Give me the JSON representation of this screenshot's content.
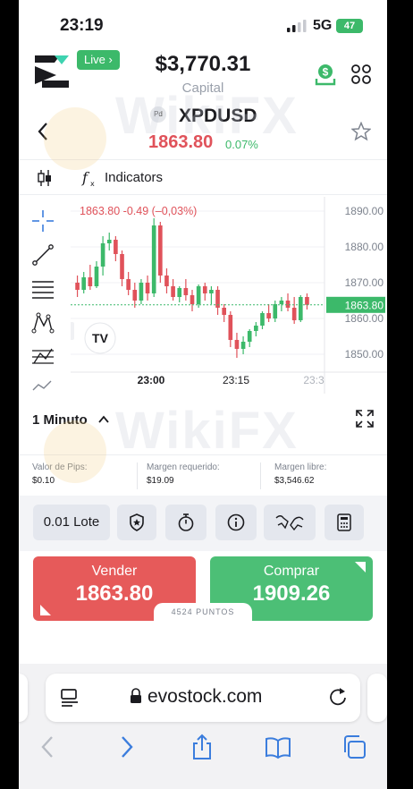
{
  "status_bar": {
    "time": "23:19",
    "network": "5G",
    "battery": "47"
  },
  "header": {
    "live_label": "Live ›",
    "capital_value": "$3,770.31",
    "capital_label": "Capital"
  },
  "instrument": {
    "badge": "Pd",
    "symbol": "XPDUSD",
    "price": "1863.80",
    "change": "0.07%"
  },
  "toolbar": {
    "indicators_label": "Indicators"
  },
  "chart_data": {
    "type": "candlestick",
    "legend_text": "1863.80  -0.49 (–0,03%)",
    "y_ticks": [
      "1890.00",
      "1880.00",
      "1870.00",
      "1860.00",
      "1850.00"
    ],
    "x_ticks": [
      "23:00",
      "23:15",
      "23:3"
    ],
    "last_price_label": "1863.80",
    "ylim": [
      1846,
      1893
    ],
    "candles": [
      {
        "o": 1870.0,
        "h": 1872.0,
        "c": 1868.0,
        "l": 1866.0
      },
      {
        "o": 1868.0,
        "h": 1873.0,
        "c": 1871.5,
        "l": 1867.0
      },
      {
        "o": 1871.5,
        "h": 1875.0,
        "c": 1869.0,
        "l": 1868.0
      },
      {
        "o": 1869.0,
        "h": 1876.0,
        "c": 1874.5,
        "l": 1868.5
      },
      {
        "o": 1874.5,
        "h": 1883.0,
        "c": 1881.0,
        "l": 1872.0
      },
      {
        "o": 1881.0,
        "h": 1884.0,
        "c": 1882.0,
        "l": 1879.0
      },
      {
        "o": 1882.0,
        "h": 1883.0,
        "c": 1878.0,
        "l": 1876.0
      },
      {
        "o": 1878.0,
        "h": 1879.0,
        "c": 1871.0,
        "l": 1869.0
      },
      {
        "o": 1871.0,
        "h": 1873.0,
        "c": 1868.0,
        "l": 1866.5
      },
      {
        "o": 1868.0,
        "h": 1870.0,
        "c": 1865.0,
        "l": 1863.0
      },
      {
        "o": 1865.0,
        "h": 1871.0,
        "c": 1870.0,
        "l": 1864.0
      },
      {
        "o": 1870.0,
        "h": 1872.0,
        "c": 1867.0,
        "l": 1865.0
      },
      {
        "o": 1867.0,
        "h": 1888.0,
        "c": 1886.0,
        "l": 1866.0
      },
      {
        "o": 1886.0,
        "h": 1887.0,
        "c": 1872.0,
        "l": 1870.0
      },
      {
        "o": 1872.0,
        "h": 1874.0,
        "c": 1869.0,
        "l": 1867.0
      },
      {
        "o": 1869.0,
        "h": 1871.0,
        "c": 1866.0,
        "l": 1865.0
      },
      {
        "o": 1866.0,
        "h": 1869.0,
        "c": 1868.5,
        "l": 1864.5
      },
      {
        "o": 1868.5,
        "h": 1871.0,
        "c": 1866.5,
        "l": 1865.0
      },
      {
        "o": 1866.5,
        "h": 1868.0,
        "c": 1864.0,
        "l": 1862.0
      },
      {
        "o": 1864.0,
        "h": 1869.5,
        "c": 1869.0,
        "l": 1863.0
      },
      {
        "o": 1869.0,
        "h": 1870.0,
        "c": 1867.0,
        "l": 1865.0
      },
      {
        "o": 1867.0,
        "h": 1869.0,
        "c": 1868.0,
        "l": 1864.0
      },
      {
        "o": 1868.0,
        "h": 1869.0,
        "c": 1863.0,
        "l": 1861.0
      },
      {
        "o": 1863.0,
        "h": 1864.0,
        "c": 1861.0,
        "l": 1859.0
      },
      {
        "o": 1861.0,
        "h": 1862.0,
        "c": 1854.0,
        "l": 1852.0
      },
      {
        "o": 1854.0,
        "h": 1856.0,
        "c": 1851.5,
        "l": 1849.0
      },
      {
        "o": 1851.5,
        "h": 1855.0,
        "c": 1853.5,
        "l": 1850.0
      },
      {
        "o": 1853.5,
        "h": 1857.0,
        "c": 1856.5,
        "l": 1852.0
      },
      {
        "o": 1856.5,
        "h": 1859.0,
        "c": 1858.0,
        "l": 1855.0
      },
      {
        "o": 1858.0,
        "h": 1862.0,
        "c": 1861.5,
        "l": 1857.0
      },
      {
        "o": 1861.5,
        "h": 1864.0,
        "c": 1860.0,
        "l": 1859.0
      },
      {
        "o": 1860.0,
        "h": 1865.0,
        "c": 1864.0,
        "l": 1859.0
      },
      {
        "o": 1864.0,
        "h": 1866.0,
        "c": 1865.0,
        "l": 1862.0
      },
      {
        "o": 1865.0,
        "h": 1867.0,
        "c": 1863.0,
        "l": 1862.0
      },
      {
        "o": 1863.0,
        "h": 1866.0,
        "c": 1859.5,
        "l": 1858.5
      },
      {
        "o": 1859.5,
        "h": 1866.5,
        "c": 1866.0,
        "l": 1859.0
      },
      {
        "o": 1866.0,
        "h": 1867.0,
        "c": 1863.8,
        "l": 1862.5
      }
    ],
    "colors": {
      "up": "#3cb96a",
      "down": "#e0525a",
      "price_line": "#3cb96a"
    }
  },
  "chart_footer": {
    "timeframe": "1 Minuto"
  },
  "metrics": [
    {
      "label": "Valor de Pips:",
      "value": "$0.10"
    },
    {
      "label": "Margen requerido:",
      "value": "$19.09"
    },
    {
      "label": "Margen libre:",
      "value": "$3,546.62"
    }
  ],
  "actions": {
    "lot_label": "0.01 Lote"
  },
  "trade": {
    "sell_label": "Vender",
    "sell_price": "1863.80",
    "buy_label": "Comprar",
    "buy_price": "1909.26",
    "spread": "4524 PUNTOS"
  },
  "browser": {
    "url": "evostock.com"
  },
  "watermark": {
    "text": "WikiFX"
  },
  "icons": {
    "dollar": "dollar-download-icon",
    "grid": "grid-icon",
    "star": "star-icon",
    "back": "back-icon",
    "crosshair": "crosshair-icon",
    "trendline": "trendline-icon",
    "fib": "fibonacci-icon",
    "pattern": "pattern-icon",
    "pitchfork": "pitchfork-icon"
  }
}
